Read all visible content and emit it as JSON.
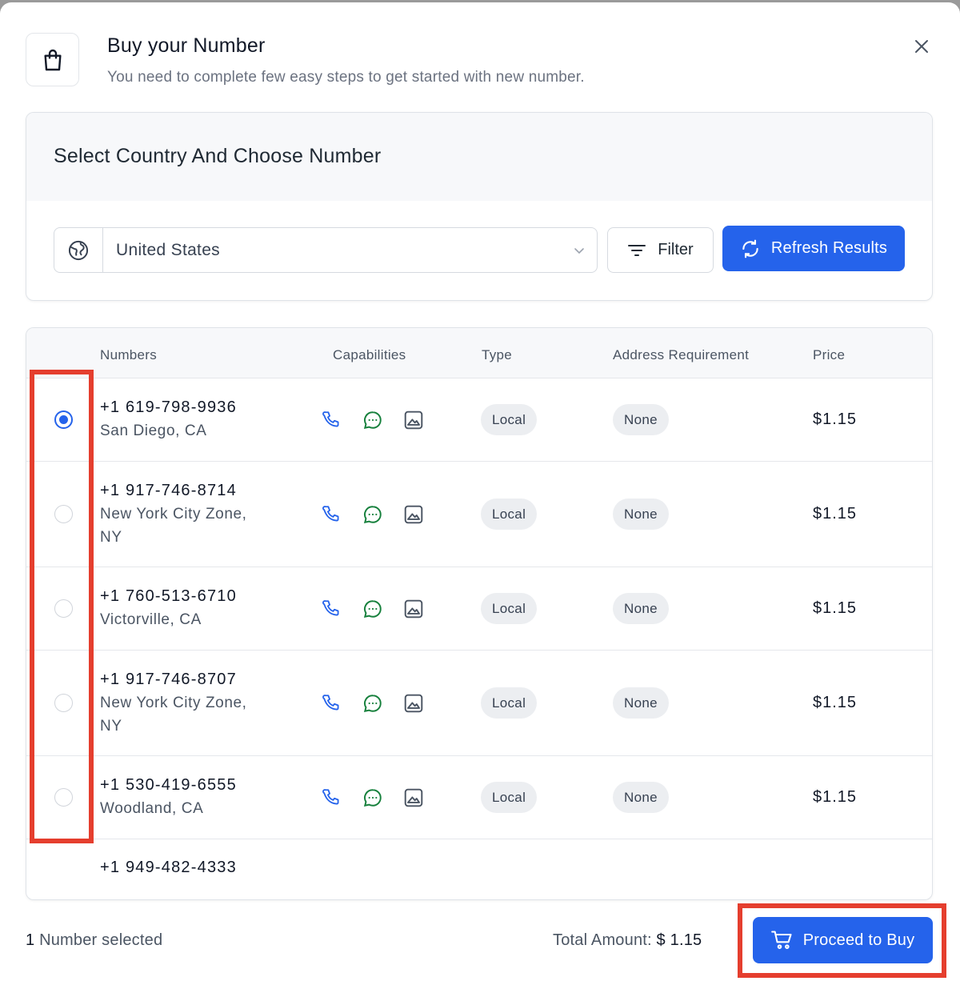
{
  "header": {
    "title": "Buy your Number",
    "subtitle": "You need to complete few easy steps to get started with new number."
  },
  "panel": {
    "title": "Select Country And Choose Number",
    "country": "United States",
    "filter_label": "Filter",
    "refresh_label": "Refresh Results"
  },
  "table": {
    "columns": [
      "Numbers",
      "Capabilities",
      "Type",
      "Address Requirement",
      "Price"
    ],
    "rows": [
      {
        "number": "+1 619-798-9936",
        "location": "San Diego, CA",
        "type": "Local",
        "address": "None",
        "price": "$1.15",
        "selected": true
      },
      {
        "number": "+1 917-746-8714",
        "location": "New York City Zone, NY",
        "type": "Local",
        "address": "None",
        "price": "$1.15",
        "selected": false
      },
      {
        "number": "+1 760-513-6710",
        "location": "Victorville, CA",
        "type": "Local",
        "address": "None",
        "price": "$1.15",
        "selected": false
      },
      {
        "number": "+1 917-746-8707",
        "location": "New York City Zone, NY",
        "type": "Local",
        "address": "None",
        "price": "$1.15",
        "selected": false
      },
      {
        "number": "+1 530-419-6555",
        "location": "Woodland, CA",
        "type": "Local",
        "address": "None",
        "price": "$1.15",
        "selected": false
      },
      {
        "number": "+1 949-482-4333",
        "location": "",
        "type": "",
        "address": "",
        "price": "",
        "selected": false
      }
    ]
  },
  "footer": {
    "selected_count": "1",
    "selected_text": " Number selected",
    "total_label": "Total Amount: ",
    "total_value": "$ 1.15",
    "buy_label": "Proceed to Buy"
  },
  "icons": {
    "header": "shopping-bag-icon",
    "close": "close-icon",
    "country": "globe-icon",
    "dropdown": "chevron-down-icon",
    "filter": "filter-lines-icon",
    "refresh": "refresh-icon",
    "voice": "phone-icon",
    "sms": "chat-bubble-icon",
    "mms": "image-icon",
    "buy": "cart-icon"
  },
  "colors": {
    "accent": "#2563eb",
    "highlight": "#e53e2e",
    "voice_icon": "#2563eb",
    "sms_icon": "#16803c",
    "mms_icon": "#4b5563"
  }
}
